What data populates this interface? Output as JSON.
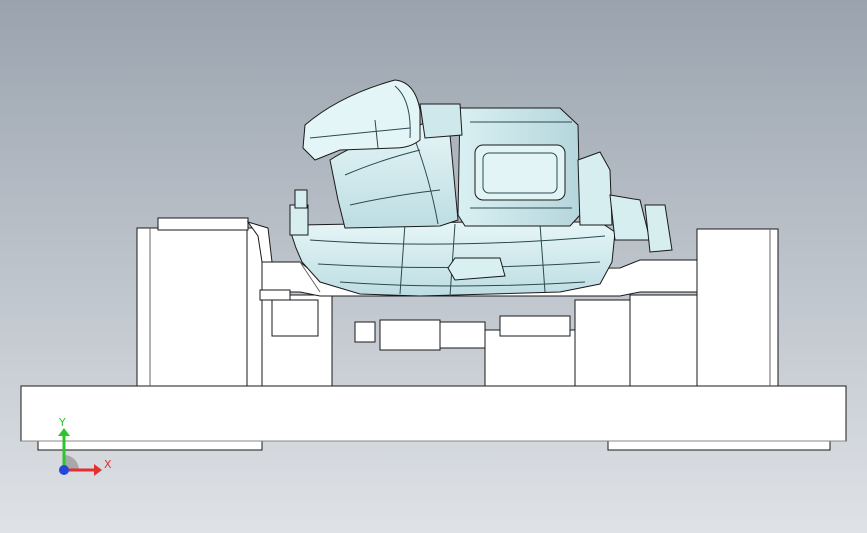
{
  "app": {
    "view": "front-orthographic-cad-view"
  },
  "triad": {
    "x_label": "X",
    "y_label": "Y",
    "x_color": "#e03030",
    "y_color": "#2ec42e",
    "z_color": "#2546d8",
    "x_icon": "x-axis-arrow",
    "y_icon": "y-axis-arrow",
    "z_icon": "z-axis-dot"
  },
  "colors": {
    "background_top": "#9aa3ae",
    "background_bottom": "#dfe2e6",
    "part_fill": "#cfe8ec",
    "part_highlight": "#eaf7f8",
    "fixture_fill": "#ffffff",
    "edge_color": "#1a1a1a"
  }
}
